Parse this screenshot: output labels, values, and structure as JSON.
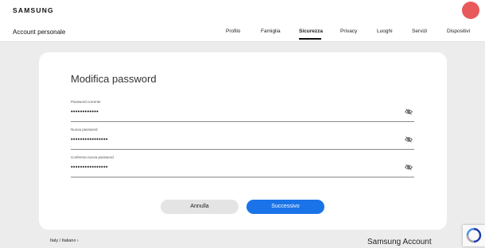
{
  "header": {
    "logo": "SAMSUNG",
    "title": "Account personale",
    "tabs": [
      {
        "label": "Profilo"
      },
      {
        "label": "Famiglia"
      },
      {
        "label": "Sicurezza"
      },
      {
        "label": "Privacy"
      },
      {
        "label": "Luoghi"
      },
      {
        "label": "Servizi"
      },
      {
        "label": "Dispositivi"
      }
    ],
    "active_tab": "Sicurezza"
  },
  "form": {
    "title": "Modifica password",
    "fields": [
      {
        "label": "Password corrente",
        "value": "••••••••••••"
      },
      {
        "label": "Nuova password",
        "value": "••••••••••••••••"
      },
      {
        "label": "Conferma nuova password",
        "value": "••••••••••••••••"
      }
    ],
    "cancel_label": "Annulla",
    "next_label": "Successivo"
  },
  "footer": {
    "language": "Italy / Italiano ›",
    "brand": "Samsung Account"
  },
  "colors": {
    "accent": "#1a73e8",
    "avatar": "#e8595b",
    "cancel_bg": "#e4e4e4",
    "page_bg": "#ececec"
  }
}
